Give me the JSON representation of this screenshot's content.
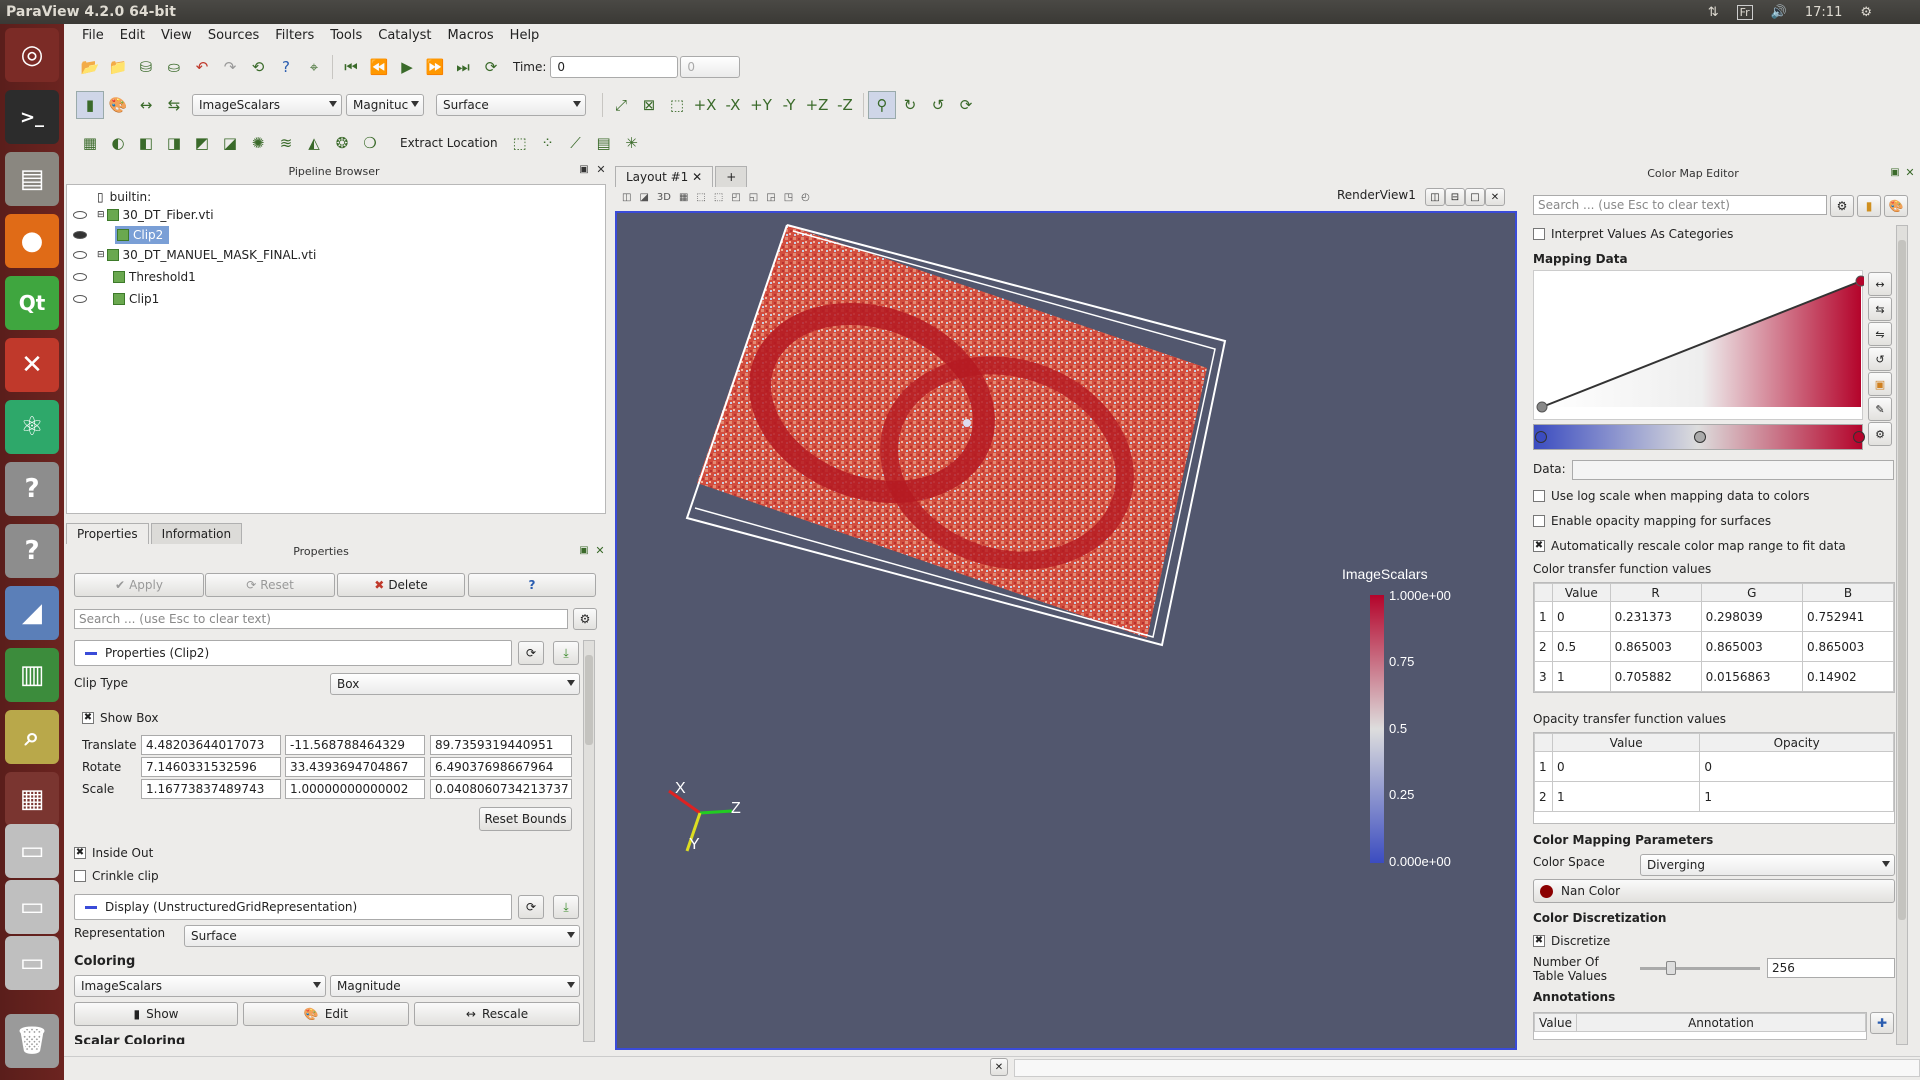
{
  "window_title": "ParaView 4.2.0 64-bit",
  "tray": {
    "lang": "Fr",
    "time": "17:11"
  },
  "launcher": [
    "ubuntu-icon",
    "terminal-icon",
    "files-icon",
    "firefox-icon",
    "qt-icon",
    "settings-icon",
    "atom-icon",
    "unknown-icon",
    "unknown-icon",
    "dolphin-icon",
    "libreoffice-icon",
    "magnifier-icon",
    "workspace-icon",
    "drive-icon",
    "drive-icon",
    "drive-icon",
    "trash-icon"
  ],
  "menu": [
    "File",
    "Edit",
    "View",
    "Sources",
    "Filters",
    "Tools",
    "Catalyst",
    "Macros",
    "Help"
  ],
  "toolbar": {
    "time_label": "Time:",
    "time_value": "0",
    "time_index": "0",
    "color_array": "ImageScalars",
    "color_component": "Magnituc",
    "representation": "Surface",
    "extract_location": "Extract Location"
  },
  "pipeline": {
    "title": "Pipeline Browser",
    "items": [
      {
        "label": "builtin:"
      },
      {
        "label": "30_DT_Fiber.vti"
      },
      {
        "label": "Clip2"
      },
      {
        "label": "30_DT_MANUEL_MASK_FINAL.vti"
      },
      {
        "label": "Threshold1"
      },
      {
        "label": "Clip1"
      }
    ]
  },
  "tabs": {
    "properties": "Properties",
    "information": "Information"
  },
  "properties": {
    "title": "Properties",
    "apply": "Apply",
    "reset": "Reset",
    "delete": "Delete",
    "help": "?",
    "search_placeholder": "Search ... (use Esc to clear text)",
    "section": "Properties (Clip2)",
    "clip_type_label": "Clip Type",
    "clip_type": "Box",
    "show_box": "Show Box",
    "translate_label": "Translate",
    "translate": [
      "4.48203644017073",
      "-11.568788464329",
      "89.7359319440951"
    ],
    "rotate_label": "Rotate",
    "rotate": [
      "7.1460331532596",
      "33.4393694704867",
      "6.49037698667964"
    ],
    "scale_label": "Scale",
    "scale": [
      "1.16773837489743",
      "1.00000000000002",
      "0.0408060734213737"
    ],
    "reset_bounds": "Reset Bounds",
    "inside_out": "Inside Out",
    "crinkle_clip": "Crinkle clip",
    "display_section": "Display (UnstructuredGridRepresentation)",
    "representation_label": "Representation",
    "representation": "Surface",
    "coloring": "Coloring",
    "color_array": "ImageScalars",
    "color_mode": "Magnitude",
    "show": "Show",
    "edit": "Edit",
    "rescale": "Rescale",
    "scalar_coloring": "Scalar Coloring"
  },
  "layout": {
    "tab": "Layout #1",
    "add": "+",
    "view_name": "RenderView1",
    "view_3d": "3D"
  },
  "colorbar": {
    "title": "ImageScalars",
    "max": "1.000e+00",
    "t075": "0.75",
    "t05": "0.5",
    "t025": "0.25",
    "min": "0.000e+00"
  },
  "axes": {
    "x": "X",
    "y": "Y",
    "z": "Z"
  },
  "cme": {
    "title": "Color Map Editor",
    "search_placeholder": "Search ... (use Esc to clear text)",
    "interpret": "Interpret Values As Categories",
    "mapping_data": "Mapping Data",
    "data_label": "Data:",
    "log_scale": "Use log scale when mapping data to colors",
    "opacity_mapping": "Enable opacity mapping for surfaces",
    "auto_rescale": "Automatically rescale color map range to fit data",
    "ctf_label": "Color transfer function values",
    "ctf_headers": [
      "Value",
      "R",
      "G",
      "B"
    ],
    "ctf_rows": [
      {
        "idx": "1",
        "v": "0",
        "r": "0.231373",
        "g": "0.298039",
        "b": "0.752941"
      },
      {
        "idx": "2",
        "v": "0.5",
        "r": "0.865003",
        "g": "0.865003",
        "b": "0.865003"
      },
      {
        "idx": "3",
        "v": "1",
        "r": "0.705882",
        "g": "0.0156863",
        "b": "0.14902"
      }
    ],
    "otf_label": "Opacity transfer function values",
    "otf_headers": [
      "Value",
      "Opacity"
    ],
    "otf_rows": [
      {
        "idx": "1",
        "v": "0",
        "o": "0"
      },
      {
        "idx": "2",
        "v": "1",
        "o": "1"
      }
    ],
    "mapping_params": "Color Mapping Parameters",
    "color_space_label": "Color Space",
    "color_space": "Diverging",
    "nan_color": "Nan Color",
    "discretization": "Color Discretization",
    "discretize": "Discretize",
    "num_table_label1": "Number Of",
    "num_table_label2": "Table Values",
    "num_table_value": "256",
    "annotations": "Annotations",
    "ann_headers": [
      "Value",
      "Annotation"
    ]
  },
  "colors": {
    "accent": "#3a4bd8",
    "selection": "#7a9fd6",
    "launcher": "#6c2420"
  }
}
